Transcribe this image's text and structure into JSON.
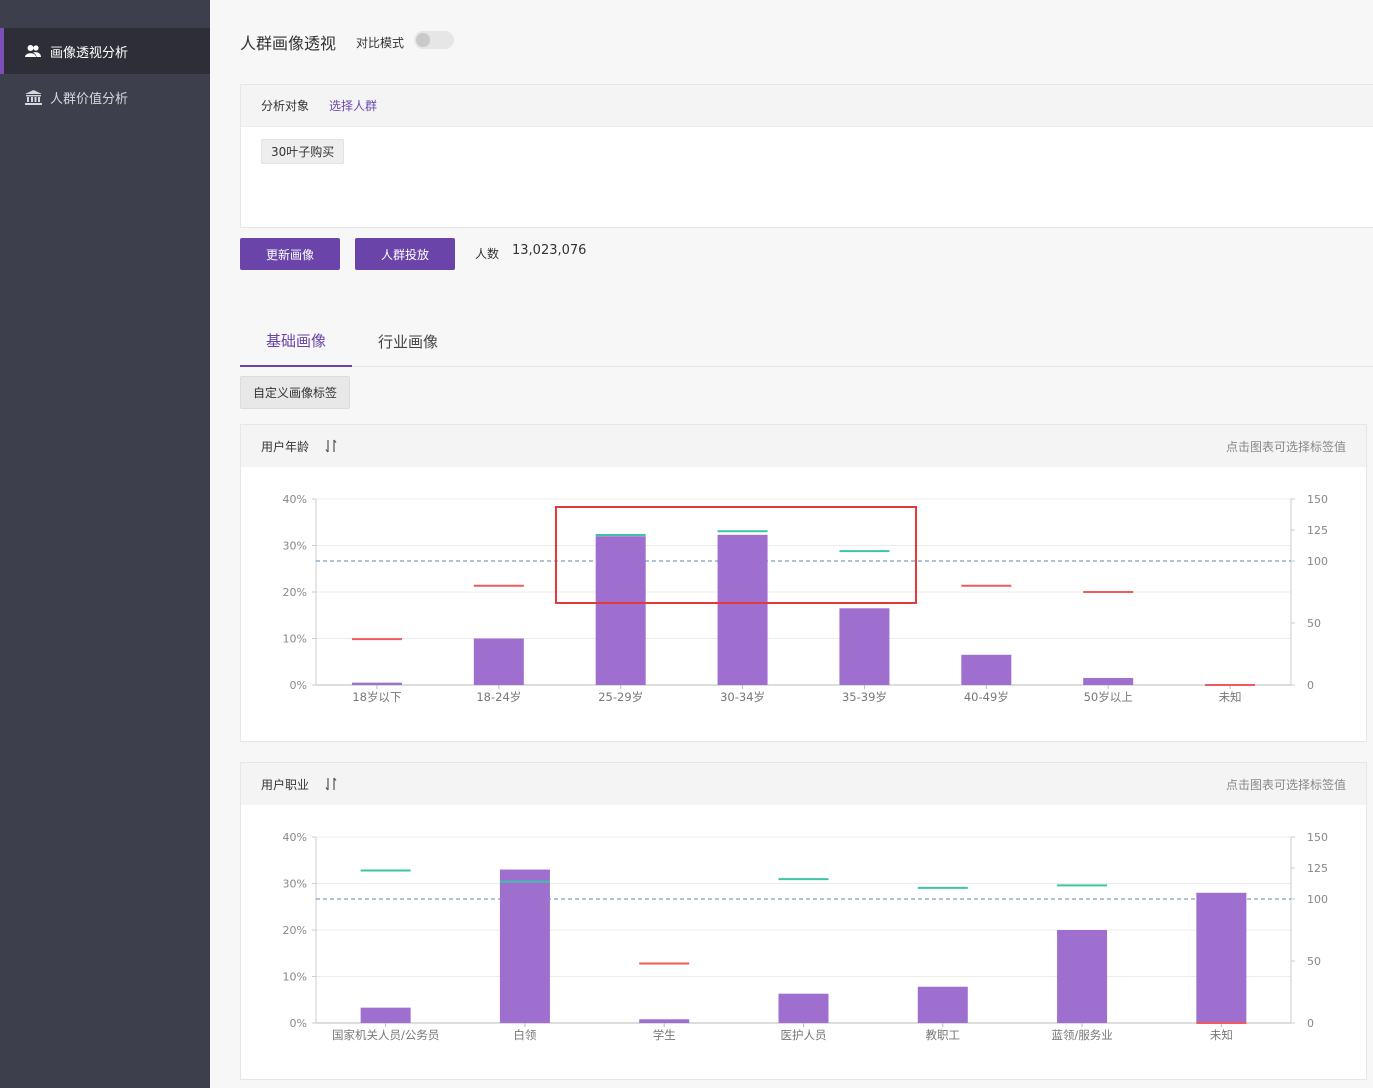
{
  "sidebar": {
    "items": [
      {
        "label": "画像透视分析",
        "icon": "users-icon",
        "active": true
      },
      {
        "label": "人群价值分析",
        "icon": "bank-icon",
        "active": false
      }
    ]
  },
  "header": {
    "title": "人群画像透视",
    "compare_mode_label": "对比模式",
    "compare_mode_on": false
  },
  "target": {
    "label": "分析对象",
    "select_link": "选择人群",
    "chip": "30叶子购买"
  },
  "actions": {
    "refresh_label": "更新画像",
    "deliver_label": "人群投放",
    "count_label": "人数",
    "count_value": "13,023,076"
  },
  "tabs": [
    {
      "label": "基础画像",
      "active": true
    },
    {
      "label": "行业画像",
      "active": false
    }
  ],
  "custom_tag_label": "自定义画像标签",
  "panels": [
    {
      "title": "用户年龄",
      "hint": "点击图表可选择标签值"
    },
    {
      "title": "用户职业",
      "hint": "点击图表可选择标签值"
    }
  ],
  "colors": {
    "accent": "#6a44a8",
    "bar": "#9f6fd0",
    "index_high": "#3cc4a8",
    "index_low": "#ef5a5a",
    "baseline": "#5b8ab0",
    "highlight": "#e23a3a"
  },
  "chart_data": [
    {
      "type": "bar",
      "title": "",
      "categories": [
        "18岁以下",
        "18-24岁",
        "25-29岁",
        "30-34岁",
        "35-39岁",
        "40-49岁",
        "50岁以上",
        "未知"
      ],
      "series": [
        {
          "values": [
            0.5,
            10,
            32,
            32.3,
            16.5,
            6.5,
            1.5,
            0.1
          ],
          "axis": "left"
        },
        {
          "values": [
            37,
            80,
            121,
            124,
            108,
            80,
            75,
            0
          ],
          "axis": "right",
          "style": "marker"
        }
      ],
      "yleft_ticks": [
        "0%",
        "10%",
        "20%",
        "30%",
        "40%"
      ],
      "yleft_lim": [
        0,
        40
      ],
      "yright_ticks": [
        "0",
        "50",
        "100",
        "125",
        "150"
      ],
      "yright_lim": [
        0,
        150
      ],
      "reference_line": 100,
      "grid": true
    },
    {
      "type": "bar",
      "title": "",
      "categories": [
        "国家机关人员/公务员",
        "白领",
        "学生",
        "医护人员",
        "教职工",
        "蓝领/服务业",
        "未知"
      ],
      "series": [
        {
          "values": [
            3.3,
            33,
            0.8,
            6.3,
            7.8,
            20,
            28
          ],
          "axis": "left"
        },
        {
          "values": [
            123,
            114,
            48,
            116,
            109,
            111,
            0
          ],
          "axis": "right",
          "style": "marker"
        }
      ],
      "yleft_ticks": [
        "0%",
        "10%",
        "20%",
        "30%",
        "40%"
      ],
      "yleft_lim": [
        0,
        40
      ],
      "yright_ticks": [
        "0",
        "50",
        "100",
        "125",
        "150"
      ],
      "yright_lim": [
        0,
        150
      ],
      "reference_line": 100,
      "grid": true
    }
  ]
}
